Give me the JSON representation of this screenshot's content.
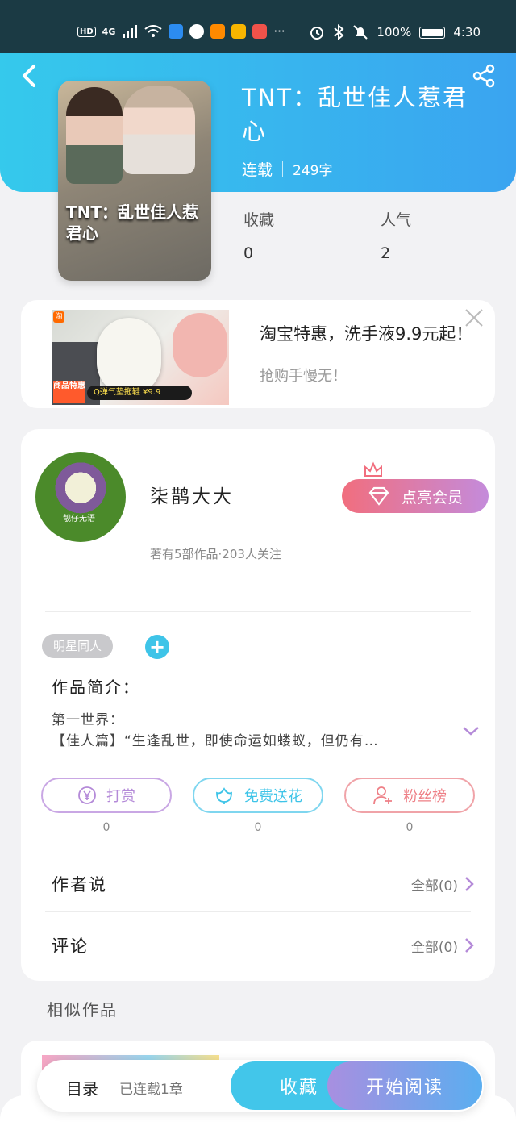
{
  "status_bar": {
    "network": "4G",
    "hd": "HD",
    "more": "···",
    "battery": "100%",
    "time": "4:30"
  },
  "book": {
    "title": "TNT：乱世佳人惹君心",
    "cover_title": "TNT：乱世佳人惹君心",
    "status": "连载",
    "word_count": "249字",
    "stats": [
      {
        "label": "收藏",
        "value": "0"
      },
      {
        "label": "人气",
        "value": "2"
      }
    ]
  },
  "ad": {
    "title": "淘宝特惠，洗手液9.9元起！",
    "subtitle": "抢购手慢无！",
    "badge": "商品特惠",
    "price_bar": "Q弹气垫拖鞋 ¥9.9",
    "platform": "淘"
  },
  "author": {
    "name": "柒鹊大大",
    "meta": "著有5部作品·203人关注",
    "avatar_watermark": "靓仔无语",
    "vip_label": "点亮会员"
  },
  "tag": "明星同人",
  "intro": {
    "label": "作品简介：",
    "line1": "第一世界：",
    "line2": "【佳人篇】“生逢乱世，即使命运如蝼蚁，但仍有…"
  },
  "actions": [
    {
      "label": "打赏",
      "count": "0",
      "color": "#b48ad8",
      "icon": "yen-icon"
    },
    {
      "label": "免费送花",
      "count": "0",
      "color": "#3ec4e8",
      "icon": "flower-icon"
    },
    {
      "label": "粉丝榜",
      "count": "0",
      "color": "#ee7f86",
      "icon": "fans-icon"
    }
  ],
  "rows": [
    {
      "label": "作者说",
      "more": "全部(0)"
    },
    {
      "label": "评论",
      "more": "全部(0)"
    }
  ],
  "similar": {
    "label": "相似作品"
  },
  "bottom": {
    "toc": "目录",
    "progress": "已连载1章",
    "fav": "收藏",
    "read": "开始阅读"
  },
  "colors": {
    "header_start": "#35c9ec",
    "header_end": "#3aa4f0",
    "accent_purple": "#b48ad8",
    "accent_cyan": "#3ec4e8"
  }
}
